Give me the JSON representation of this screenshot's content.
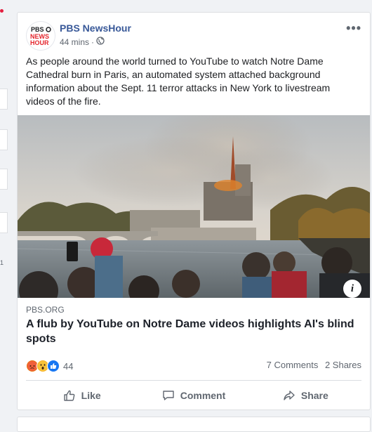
{
  "post": {
    "page_name": "PBS NewsHour",
    "time": "44 mins",
    "audience_icon": "globe-icon",
    "text": "As people around the world turned to YouTube to watch Notre Dame Cathedral burn in Paris, an automated system attached background information about the Sept. 11 terror attacks in New York to livestream videos of the fire.",
    "logo_text": [
      "PBS",
      "NEWS",
      "HOUR"
    ]
  },
  "link": {
    "domain": "PBS.ORG",
    "title": "A flub by YouTube on Notre Dame videos highlights AI's blind spots",
    "info_label": "i"
  },
  "stats": {
    "reaction_icons": [
      "angry-icon",
      "wow-icon",
      "like-icon"
    ],
    "reaction_count": "44",
    "comments": "7 Comments",
    "shares": "2 Shares"
  },
  "actions": {
    "like": "Like",
    "comment": "Comment",
    "share": "Share"
  },
  "left_strip": {
    "count": "1"
  },
  "colors": {
    "link_blue": "#385898",
    "text": "#1c1e21",
    "muted": "#606770",
    "pbs_red": "#e4252c"
  }
}
